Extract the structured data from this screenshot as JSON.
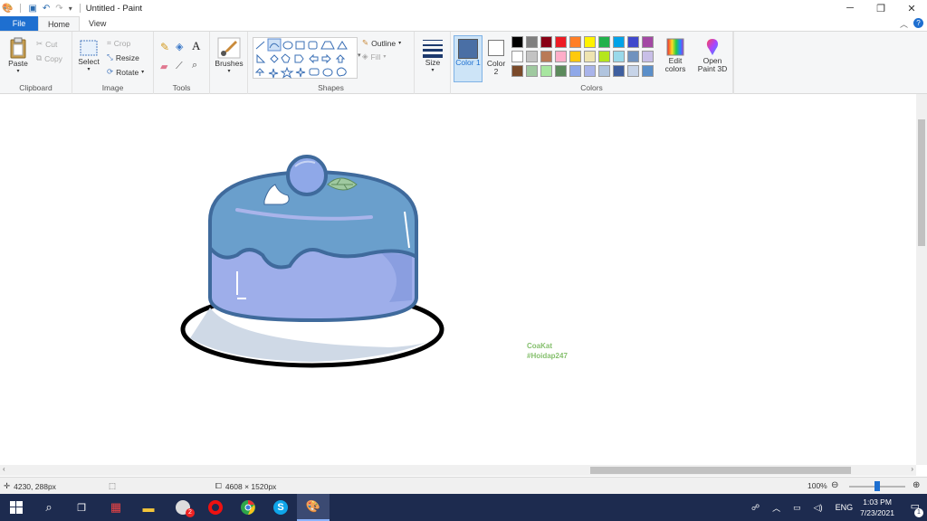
{
  "window": {
    "title": "Untitled - Paint",
    "controls": [
      "minimize-icon",
      "restore-icon",
      "close-icon"
    ]
  },
  "tabs": [
    {
      "label": "File"
    },
    {
      "label": "Home"
    },
    {
      "label": "View"
    }
  ],
  "ribbon": {
    "clipboard": {
      "paste": "Paste",
      "cut": "Cut",
      "copy": "Copy",
      "group": "Clipboard"
    },
    "image": {
      "select": "Select",
      "crop": "Crop",
      "resize": "Resize",
      "rotate": "Rotate",
      "group": "Image"
    },
    "tools": {
      "group": "Tools"
    },
    "brushes": {
      "label": "Brushes"
    },
    "shapes": {
      "outline": "Outline",
      "fill": "Fill",
      "group": "Shapes"
    },
    "size": {
      "label": "Size"
    },
    "colors": {
      "color1": "Color 1",
      "color2": "Color 2",
      "edit": "Edit colors",
      "open3d": "Open Paint 3D",
      "group": "Colors",
      "color1_value": "#4a6fa5",
      "color2_value": "#ffffff",
      "swatches": [
        "#000000",
        "#7f7f7f",
        "#880015",
        "#ed1c24",
        "#ff7f27",
        "#fff200",
        "#22b14c",
        "#00a2e8",
        "#3f48cc",
        "#a349a4",
        "#ffffff",
        "#c3c3c3",
        "#b97a57",
        "#ffaec9",
        "#ffc90e",
        "#efe4b0",
        "#b5e61d",
        "#99d9ea",
        "#7092be",
        "#c8bfe7",
        "#7a4a2a",
        "#9fc9a0",
        "#a7e6a0",
        "#5c8a5c",
        "#8fa8e8",
        "#a9b4ea",
        "#b0c4de",
        "#3f5f9f",
        "#c7d4e8",
        "#5b8fc9"
      ]
    }
  },
  "canvas": {
    "watermark_line1": "CoaKat",
    "watermark_line2": "#Hoidap247"
  },
  "status": {
    "cursor": "4230, 288px",
    "dimensions": "4608 × 1520px",
    "zoom": "100%"
  },
  "taskbar": {
    "badge": "2",
    "lang": "ENG",
    "time": "1:03 PM",
    "date": "7/23/2021",
    "notifications": "1"
  }
}
